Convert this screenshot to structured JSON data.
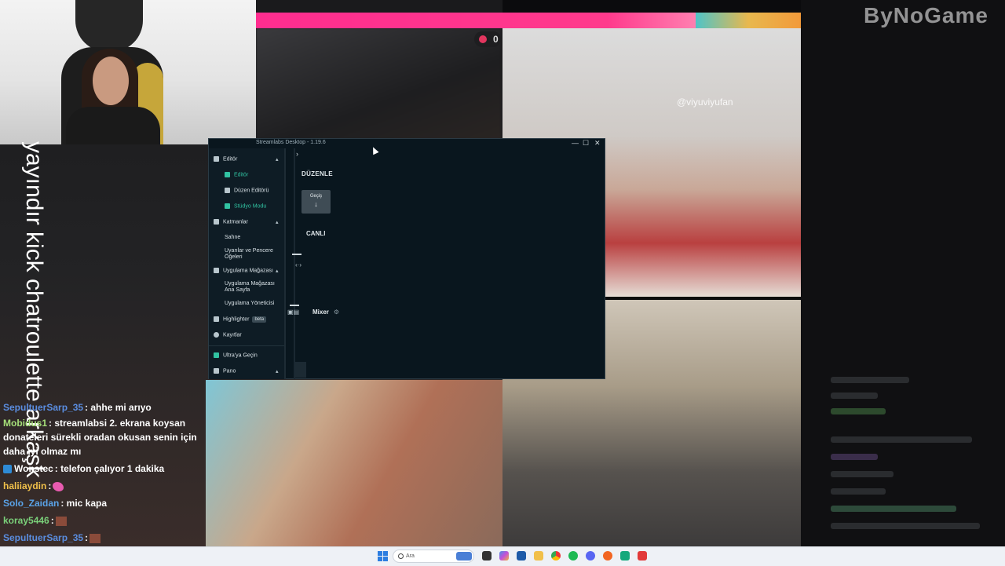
{
  "stream": {
    "watermark": "ByNoGame",
    "overlay_handle": "@viyuviyufan",
    "live_count": "0",
    "vertical_text": "yayındır kick chatroulette arkaşk",
    "colors": {
      "pink_bar": "#ff2d8f",
      "accent": "#31c3a2"
    }
  },
  "chat": {
    "messages": [
      {
        "user": "SepultuerSarp_35",
        "text": ": ahhe mi arıyo",
        "color": "#5a8de0"
      },
      {
        "user": "Mobidus1",
        "text": ": streamlabsi 2. ekrana koysan",
        "color": "#a6e07a"
      },
      {
        "user": "",
        "text": "donateleri sürekli oradan okusan senin için",
        "color": "#ffffff"
      },
      {
        "user": "",
        "text": "daha iyi olmaz mı",
        "color": "#ffffff"
      },
      {
        "user": "Wonstec",
        "text": ": telefon çalıyor 1 dakika",
        "color": "#ffffff",
        "badge": "kick-badge-icon"
      },
      {
        "user": "haliiaydin",
        "text": ":",
        "color": "#f0c04a",
        "emote": "feather-emote"
      },
      {
        "user": "Solo_Zaidan",
        "text": ": mic kapa",
        "color": "#5aa3e8"
      },
      {
        "user": "koray5446",
        "text": ":",
        "color": "#7ad07a",
        "emote": "image-emote"
      },
      {
        "user": "SepultuerSarp_35",
        "text": ":",
        "color": "#5a8de0",
        "emote": "image-emote"
      }
    ]
  },
  "app": {
    "title": "Streamlabs Desktop - 1.19.6",
    "window_controls": {
      "minimize": "—",
      "maximize": "☐",
      "close": "✕"
    },
    "sidebar": {
      "editor": "Editör",
      "editor_sub": "Editör",
      "layout_editor": "Düzen Editörü",
      "studio_mode": "Stüdyo Modu",
      "layers": "Katmanlar",
      "scene": "Sahne",
      "alerts_line1": "Uyarılar ve Pencere",
      "alerts_line2": "Öğeleri",
      "app_store": "Uygulama Mağazası",
      "store_home_line1": "Uygulama Mağazası",
      "store_home_line2": "Ana Sayfa",
      "app_manager": "Uygulama Yöneticisi",
      "highlighter": "Highlighter",
      "beta": "beta",
      "recordings": "Kayıtlar",
      "ultra": "Ultra'ya Geçin",
      "dashboard": "Pano"
    },
    "main": {
      "edit_section": "DÜZENLE",
      "transition_label": "Geçiş",
      "transition_arrow": "↓",
      "live_section": "CANLI",
      "mixer_label": "Mixer",
      "chevron": "›"
    }
  },
  "taskbar": {
    "search_placeholder": "Ara"
  }
}
